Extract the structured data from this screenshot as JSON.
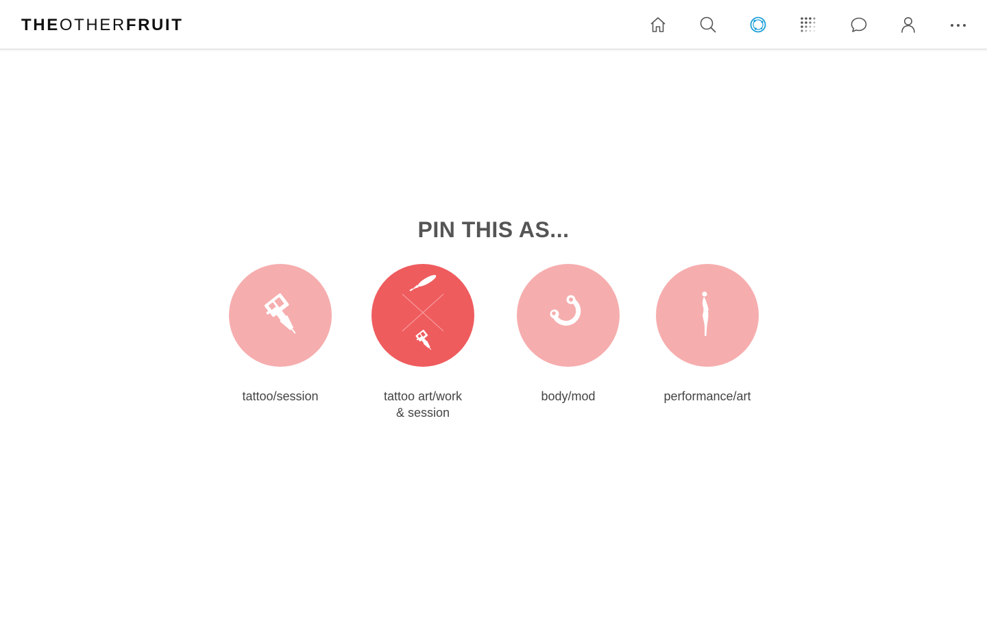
{
  "header": {
    "logo": {
      "part1": "THE",
      "part2": "OTHER",
      "part3": "FRUIT"
    },
    "nav": [
      {
        "name": "home-icon",
        "active": false
      },
      {
        "name": "search-icon",
        "active": false
      },
      {
        "name": "globe-icon",
        "active": true
      },
      {
        "name": "grid-dots-icon",
        "active": false
      },
      {
        "name": "chat-icon",
        "active": false
      },
      {
        "name": "user-icon",
        "active": false
      },
      {
        "name": "more-icon",
        "active": false
      }
    ],
    "active_color": "#1ba0d8",
    "icon_color": "#555555"
  },
  "main": {
    "heading": "PIN THIS AS...",
    "options": [
      {
        "label": "tattoo/session",
        "icon": "tattoo-machine-icon",
        "selected": false
      },
      {
        "label": "tattoo art/work\n& session",
        "icon": "brush-and-tattoo-machine-icon",
        "selected": true
      },
      {
        "label": "body/mod",
        "icon": "piercing-ring-icon",
        "selected": false
      },
      {
        "label": "performance/art",
        "icon": "performer-figure-icon",
        "selected": false
      }
    ]
  },
  "colors": {
    "circle_light": "#f6adae",
    "circle_selected": "#ef5c5e",
    "heading": "#555555",
    "label": "#444444"
  }
}
